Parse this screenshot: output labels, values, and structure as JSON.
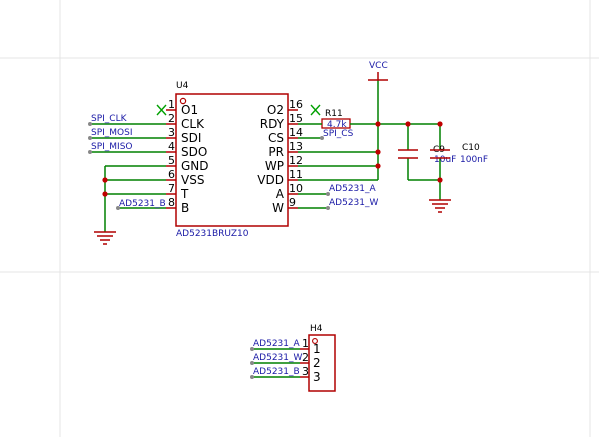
{
  "colors": {
    "wire": "#008000",
    "body": "#b00000",
    "junction": "#c00000",
    "netlabel": "#1a1aa6",
    "noconnect": "#00a000",
    "grid": "#e4e4e4"
  },
  "u4": {
    "refdes": "U4",
    "part": "AD5231BRUZ10",
    "left_pins": [
      {
        "num": "1",
        "name": "O1"
      },
      {
        "num": "2",
        "name": "CLK"
      },
      {
        "num": "3",
        "name": "SDI"
      },
      {
        "num": "4",
        "name": "SDO"
      },
      {
        "num": "5",
        "name": "GND"
      },
      {
        "num": "6",
        "name": "VSS"
      },
      {
        "num": "7",
        "name": "T"
      },
      {
        "num": "8",
        "name": "B"
      }
    ],
    "right_pins": [
      {
        "num": "16",
        "name": "O2"
      },
      {
        "num": "15",
        "name": "RDY"
      },
      {
        "num": "14",
        "name": "CS"
      },
      {
        "num": "13",
        "name": "PR"
      },
      {
        "num": "12",
        "name": "WP"
      },
      {
        "num": "11",
        "name": "VDD"
      },
      {
        "num": "10",
        "name": "A"
      },
      {
        "num": "9",
        "name": "W"
      }
    ]
  },
  "nets": {
    "spi_clk": "SPI_CLK",
    "spi_mosi": "SPI_MOSI",
    "spi_miso": "SPI_MISO",
    "spi_cs": "SPI_CS",
    "ad_a_u": "AD5231_A",
    "ad_w_u": "AD5231_W",
    "ad_b_u": "AD5231_B",
    "ad_a_h": "AD5231_A",
    "ad_w_h": "AD5231_W",
    "ad_b_h": "AD5231_B",
    "vcc": "VCC"
  },
  "r11": {
    "refdes": "R11",
    "value": "4.7k"
  },
  "c9": {
    "refdes": "C9",
    "value": "10uF"
  },
  "c10": {
    "refdes": "C10",
    "value": "100nF"
  },
  "h4": {
    "refdes": "H4",
    "pins": [
      {
        "num": "1",
        "name": "1"
      },
      {
        "num": "2",
        "name": "2"
      },
      {
        "num": "3",
        "name": "3"
      }
    ]
  }
}
